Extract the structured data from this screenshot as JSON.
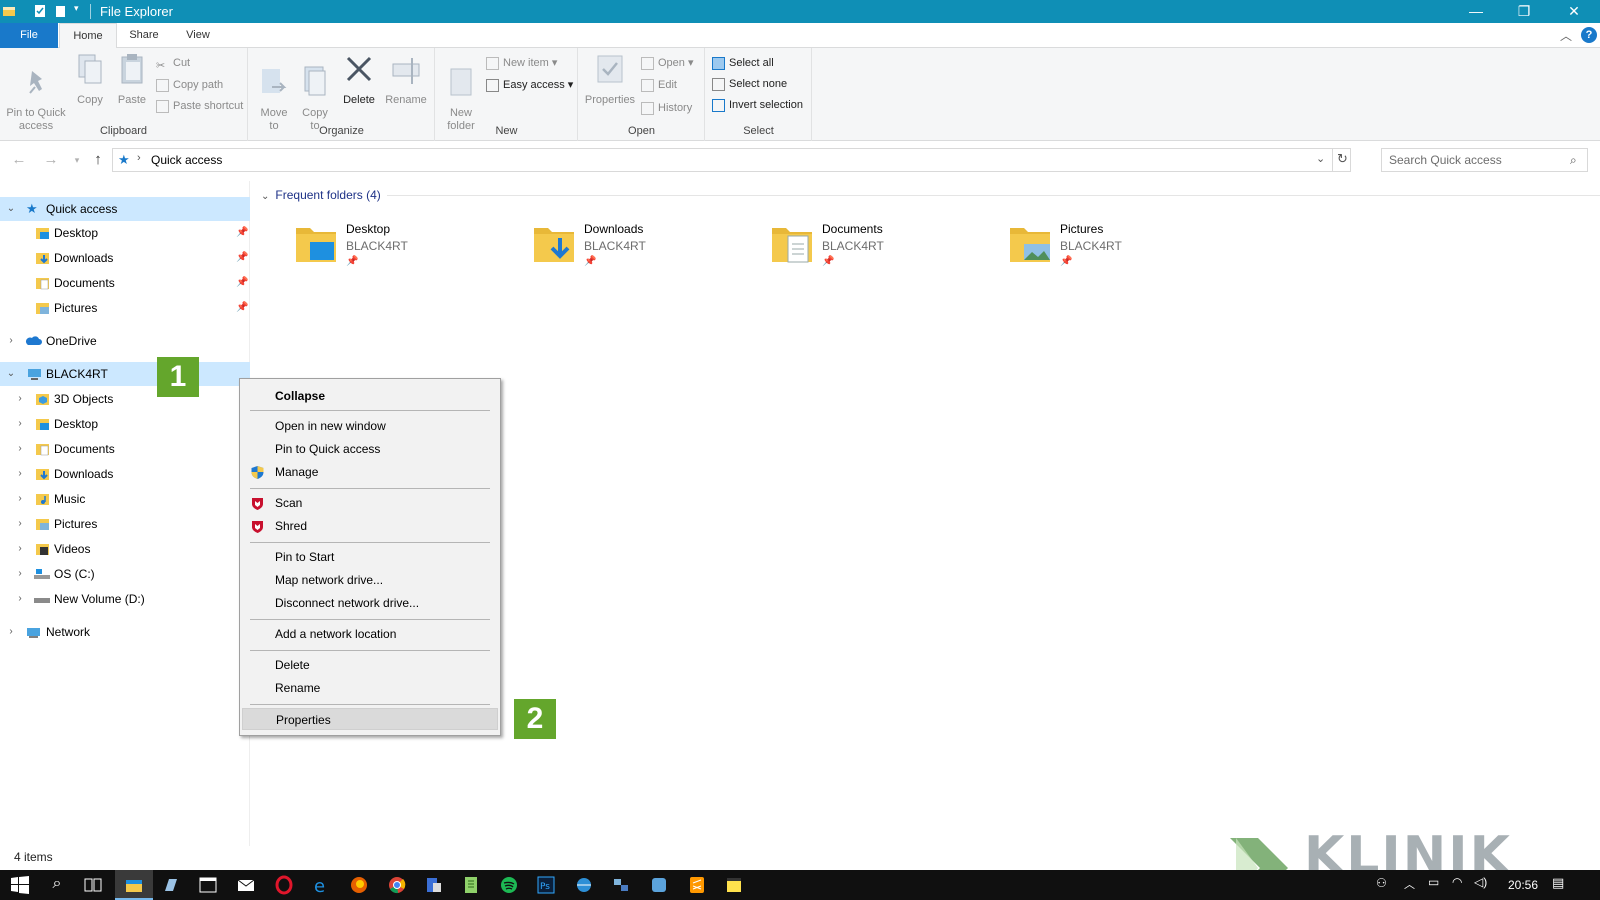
{
  "window": {
    "title": "File Explorer",
    "min_glyph": "—",
    "max_glyph": "❐",
    "close_glyph": "✕"
  },
  "ribbon_tabs": {
    "file": "File",
    "home": "Home",
    "share": "Share",
    "view": "View"
  },
  "ribbon": {
    "clipboard": {
      "label": "Clipboard",
      "pin": "Pin to Quick\naccess",
      "copy": "Copy",
      "paste": "Paste",
      "cut": "Cut",
      "copy_path": "Copy path",
      "paste_shortcut": "Paste shortcut"
    },
    "organize": {
      "label": "Organize",
      "move_to": "Move\nto",
      "copy_to": "Copy\nto",
      "delete": "Delete",
      "rename": "Rename"
    },
    "new": {
      "label": "New",
      "new_folder": "New\nfolder",
      "new_item": "New item",
      "easy_access": "Easy access"
    },
    "open": {
      "label": "Open",
      "properties": "Properties",
      "open": "Open",
      "edit": "Edit",
      "history": "History"
    },
    "select": {
      "label": "Select",
      "select_all": "Select all",
      "select_none": "Select none",
      "invert": "Invert selection"
    }
  },
  "address": {
    "path": "Quick access",
    "search_placeholder": "Search Quick access"
  },
  "nav": {
    "quick_access": "Quick access",
    "qa_items": [
      "Desktop",
      "Downloads",
      "Documents",
      "Pictures"
    ],
    "onedrive": "OneDrive",
    "pc": "BLACK4RT",
    "pc_items": [
      "3D Objects",
      "Desktop",
      "Documents",
      "Downloads",
      "Music",
      "Pictures",
      "Videos",
      "OS (C:)",
      "New Volume (D:)"
    ],
    "network": "Network"
  },
  "content": {
    "group_header": "Frequent folders (4)",
    "folders": [
      {
        "name": "Desktop",
        "location": "BLACK4RT"
      },
      {
        "name": "Downloads",
        "location": "BLACK4RT"
      },
      {
        "name": "Documents",
        "location": "BLACK4RT"
      },
      {
        "name": "Pictures",
        "location": "BLACK4RT"
      }
    ]
  },
  "status": {
    "items": "4 items"
  },
  "context_menu": {
    "collapse": "Collapse",
    "open_new_window": "Open in new window",
    "pin_quick": "Pin to Quick access",
    "manage": "Manage",
    "scan": "Scan",
    "shred": "Shred",
    "pin_start": "Pin to Start",
    "map_drive": "Map network drive...",
    "disconnect_drive": "Disconnect network drive...",
    "add_network": "Add a network location",
    "delete": "Delete",
    "rename": "Rename",
    "properties": "Properties"
  },
  "badges": {
    "one": "1",
    "two": "2"
  },
  "taskbar": {
    "time": "20:56"
  },
  "watermark": {
    "text": "KLINIK"
  },
  "colors": {
    "titlebar": "#0f8fb6",
    "file_tab": "#1979ca",
    "selection": "#cce8ff",
    "badge": "#64a62c",
    "folder": "#f4c94c"
  }
}
